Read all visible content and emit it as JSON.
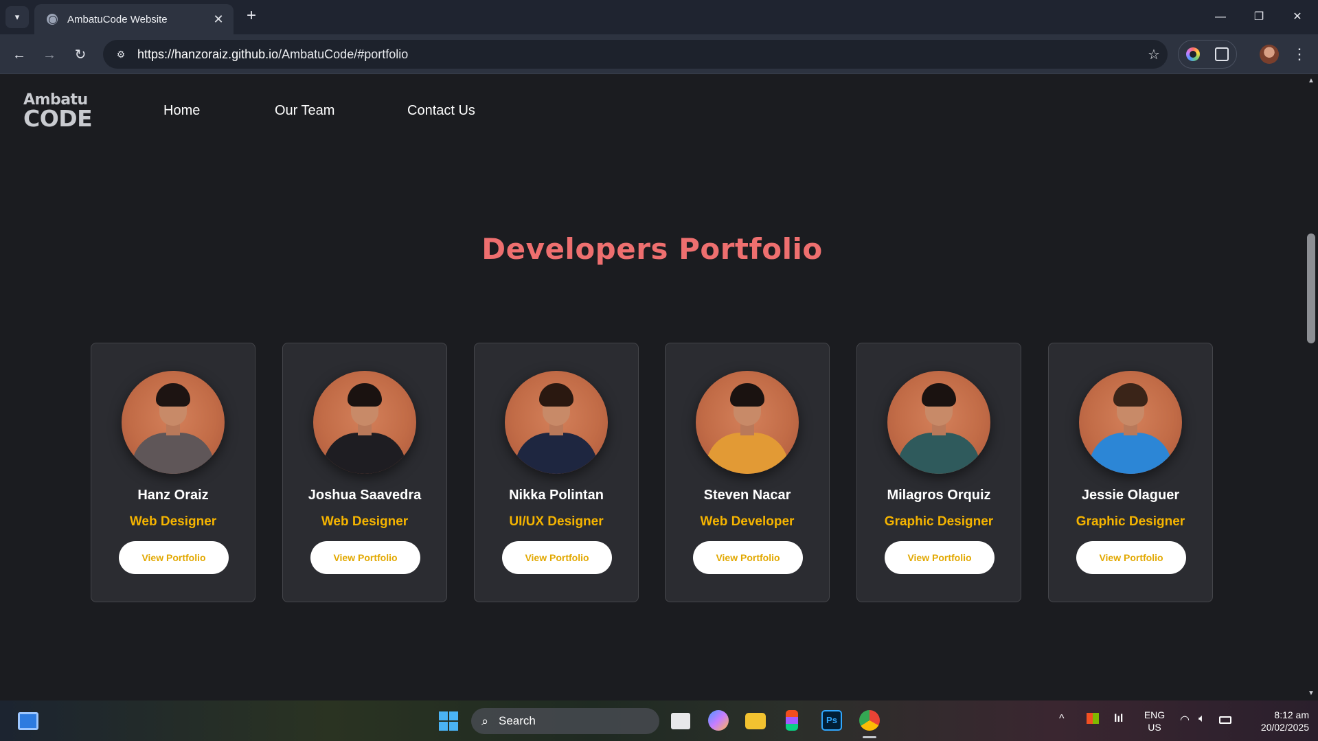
{
  "browser": {
    "tab_title": "AmbatuCode Website",
    "tab_close": "✕",
    "new_tab": "+",
    "url_host": "https://hanzoraiz.github.io",
    "url_path": "/AmbatuCode/#portfolio"
  },
  "site": {
    "logo_line1": "Ambatu",
    "logo_line2": "CODE",
    "nav": [
      "Home",
      "Our Team",
      "Contact Us"
    ]
  },
  "portfolio": {
    "title": "Developers Portfolio",
    "members": [
      {
        "name": "Hanz Oraiz",
        "role": "Web Designer",
        "button": "View Portfolio",
        "shirt_color": "#5f5658",
        "hair_color": "#1d1412"
      },
      {
        "name": "Joshua Saavedra",
        "role": "Web Designer",
        "button": "View Portfolio",
        "shirt_color": "#1e1d22",
        "hair_color": "#1a1210"
      },
      {
        "name": "Nikka Polintan",
        "role": "UI/UX Designer",
        "button": "View Portfolio",
        "shirt_color": "#1e2640",
        "hair_color": "#2a1810"
      },
      {
        "name": "Steven Nacar",
        "role": "Web Developer",
        "button": "View Portfolio",
        "shirt_color": "#e29a35",
        "hair_color": "#1a1210"
      },
      {
        "name": "Milagros Orquiz",
        "role": "Graphic Designer",
        "button": "View Portfolio",
        "shirt_color": "#2f5a5c",
        "hair_color": "#1a1210"
      },
      {
        "name": "Jessie Olaguer",
        "role": "Graphic Designer",
        "button": "View Portfolio",
        "shirt_color": "#2c86d6",
        "hair_color": "#3a2418"
      }
    ]
  },
  "taskbar": {
    "search_label": "Search",
    "lang_line1": "ENG",
    "lang_line2": "US",
    "time": "8:12 am",
    "date": "20/02/2025"
  },
  "colors": {
    "accent_title": "#ee6f6f",
    "role_gold": "#f5b400",
    "page_bg": "#1b1c20",
    "card_bg": "#2b2c31"
  }
}
